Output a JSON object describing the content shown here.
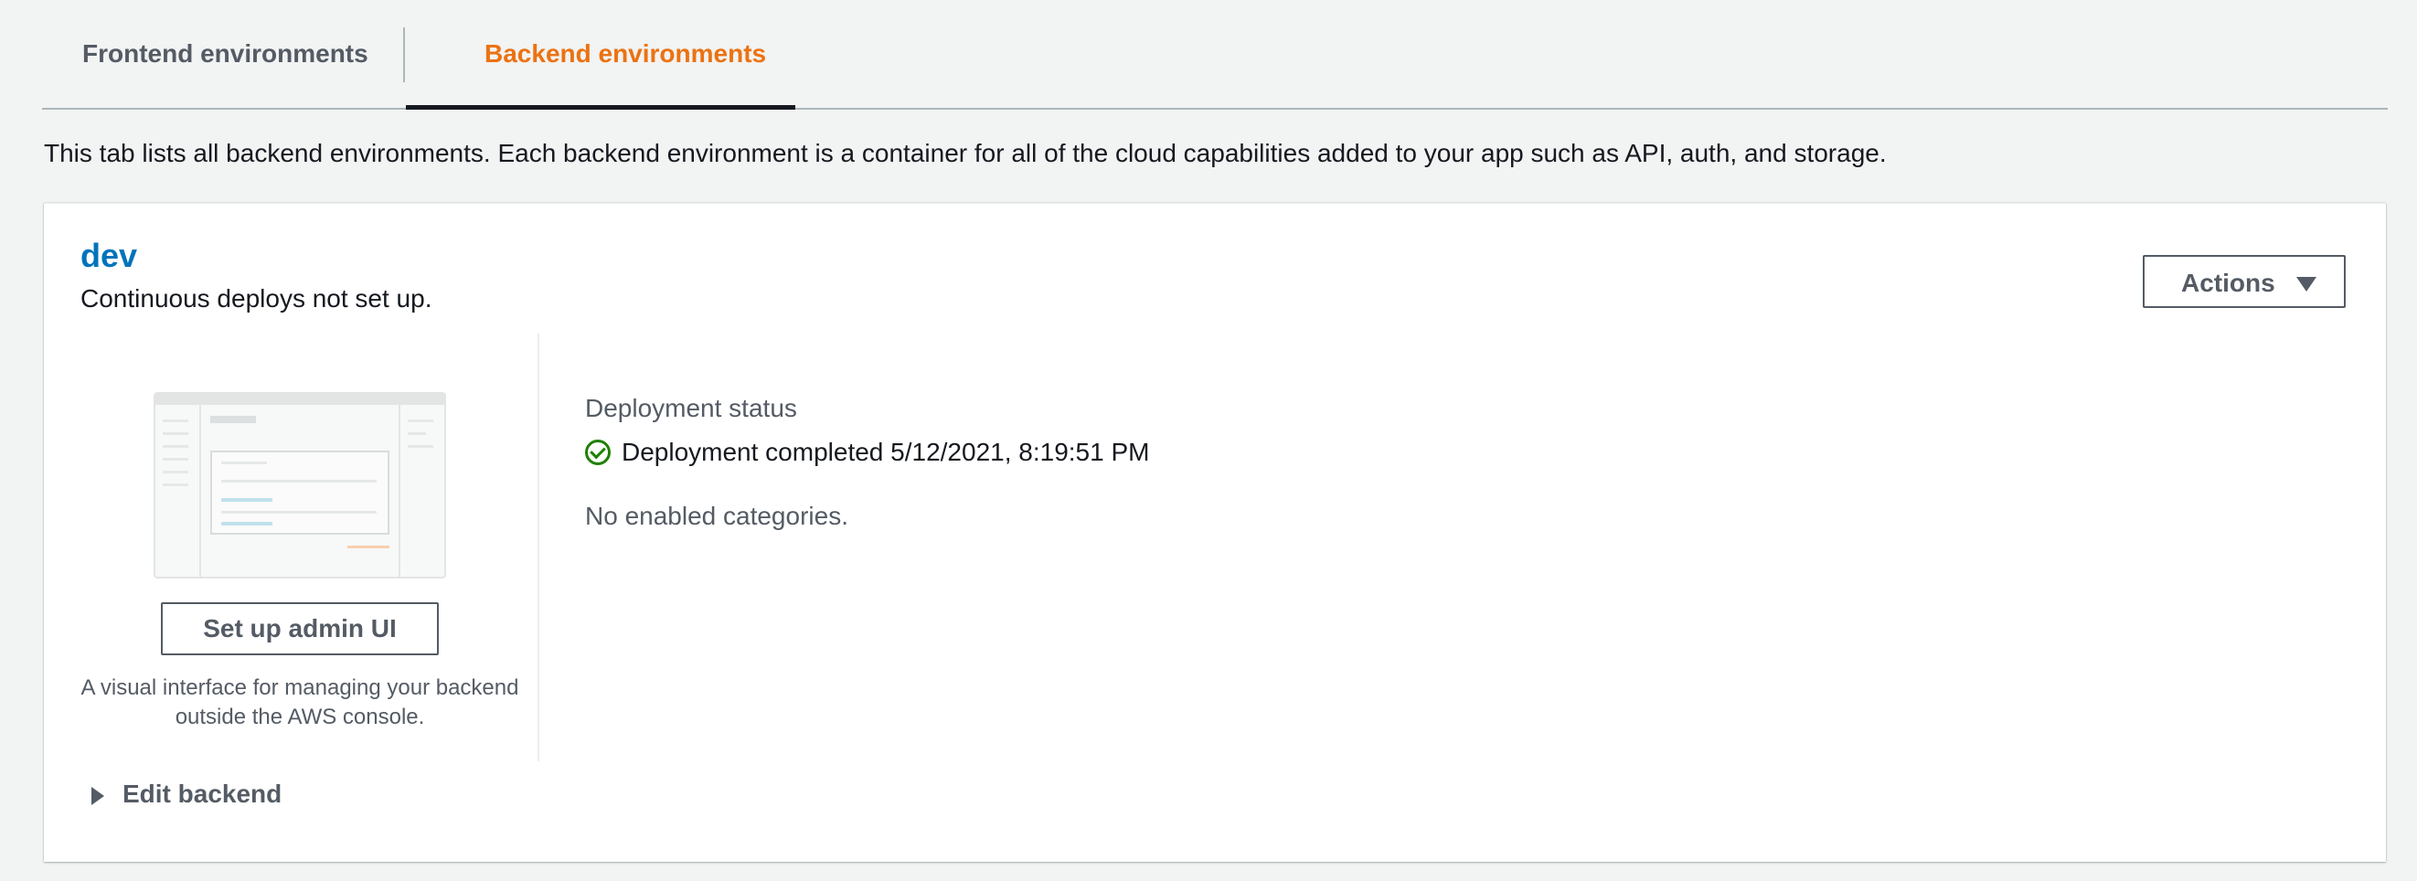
{
  "tabs": [
    {
      "label": "Frontend environments",
      "active": false
    },
    {
      "label": "Backend environments",
      "active": true
    }
  ],
  "description": "This tab lists all backend environments. Each backend environment is a container for all of the cloud capabilities added to your app such as API, auth, and storage.",
  "environment": {
    "name": "dev",
    "subtitle": "Continuous deploys not set up.",
    "actions_label": "Actions",
    "setup_button_label": "Set up admin UI",
    "setup_description": "A visual interface for managing your backend outside the AWS console.",
    "deployment_status_label": "Deployment status",
    "deployment_status_text": "Deployment completed 5/12/2021, 8:19:51 PM",
    "categories_text": "No enabled categories.",
    "edit_backend_label": "Edit backend"
  },
  "colors": {
    "accent_tab": "#ec7211",
    "link": "#0073bb",
    "success": "#1d8102"
  },
  "icons": {
    "status": "check-circle-icon",
    "actions": "caret-down-icon",
    "edit": "caret-right-icon"
  }
}
